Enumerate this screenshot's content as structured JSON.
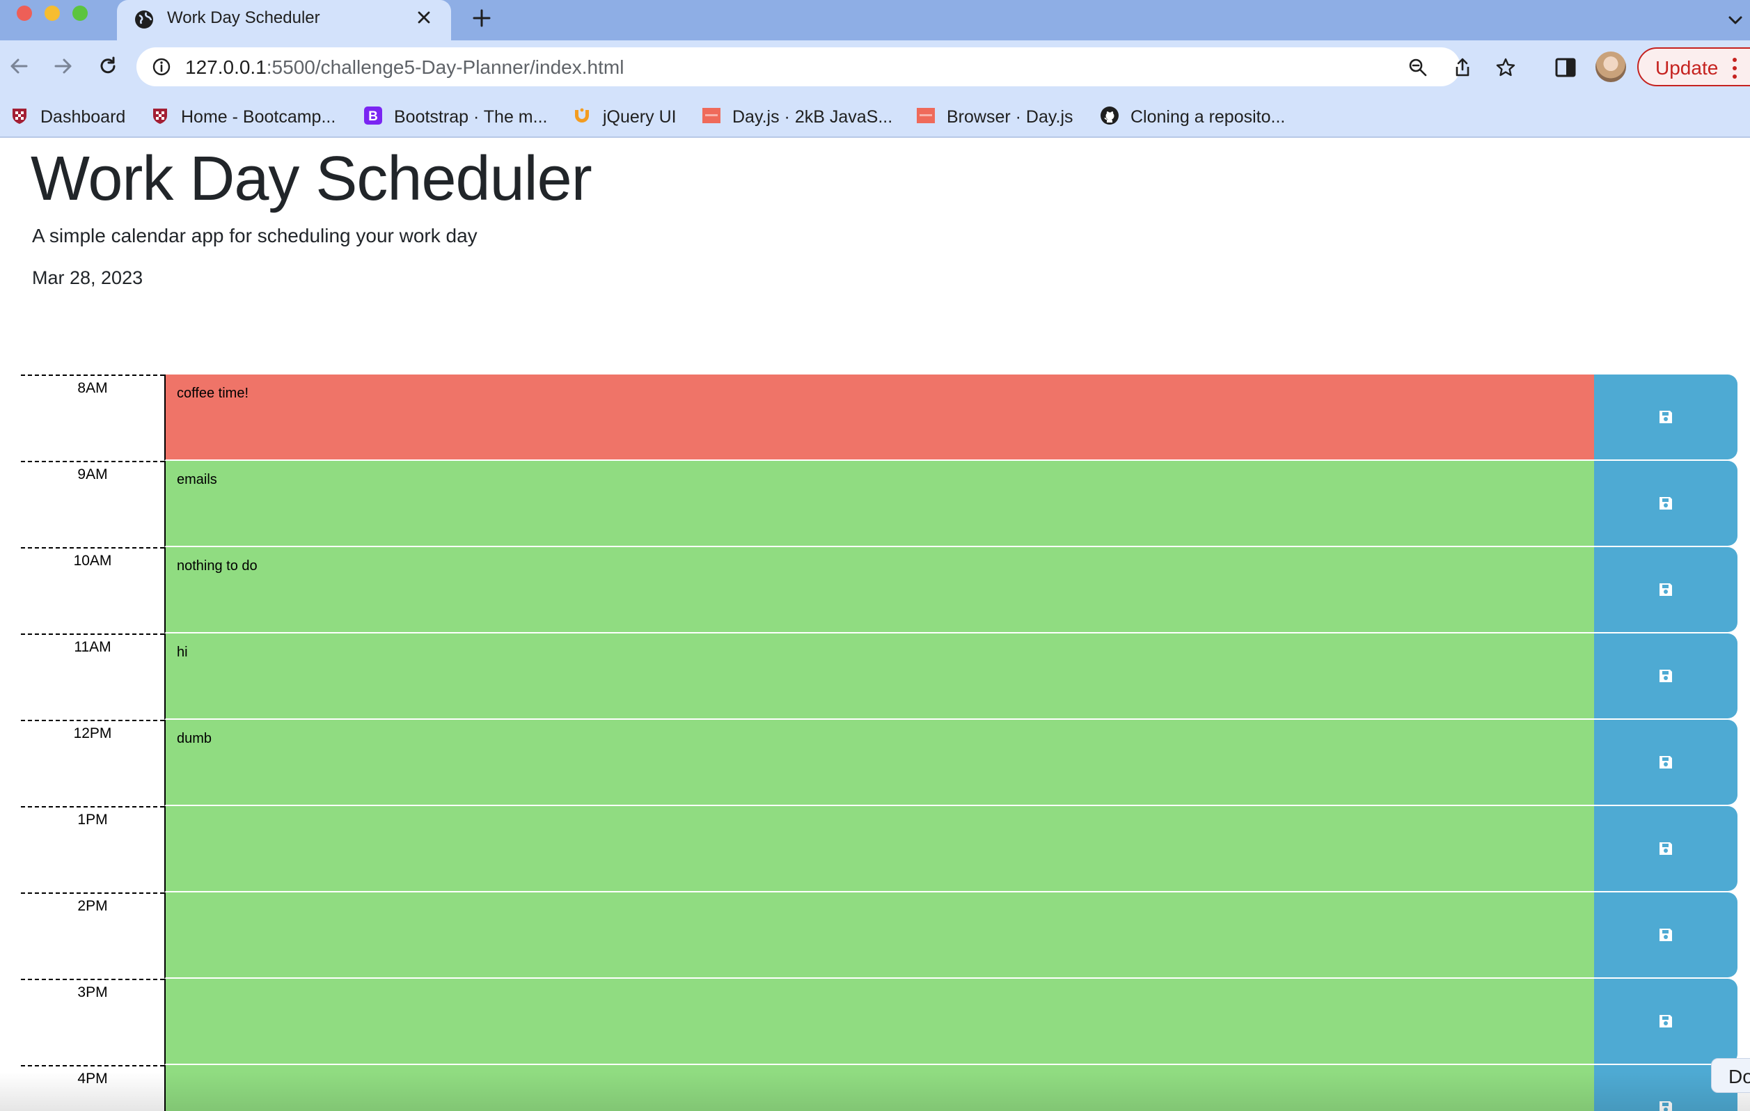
{
  "browser": {
    "tab_title": "Work Day Scheduler",
    "url_host": "127.0.0.1",
    "url_rest": ":5500/challenge5-Day-Planner/index.html",
    "update_label": "Update",
    "bookmarks": [
      {
        "label": "Dashboard",
        "icon": "shield-icon"
      },
      {
        "label": "Home - Bootcamp...",
        "icon": "shield-icon"
      },
      {
        "label": "Bootstrap · The m...",
        "icon": "bootstrap-icon"
      },
      {
        "label": "jQuery UI",
        "icon": "jquery-ui-icon"
      },
      {
        "label": "Day.js · 2kB JavaS...",
        "icon": "dayjs-icon"
      },
      {
        "label": "Browser · Day.js",
        "icon": "dayjs-icon"
      },
      {
        "label": "Cloning a reposito...",
        "icon": "github-icon"
      }
    ]
  },
  "header": {
    "title": "Work Day Scheduler",
    "lead": "A simple calendar app for scheduling your work day",
    "current_day": "Mar 28, 2023"
  },
  "timeblocks": [
    {
      "hour": "8AM",
      "text": "coffee time!",
      "state": "present"
    },
    {
      "hour": "9AM",
      "text": "emails",
      "state": "future"
    },
    {
      "hour": "10AM",
      "text": "nothing to do",
      "state": "future"
    },
    {
      "hour": "11AM",
      "text": "hi",
      "state": "future"
    },
    {
      "hour": "12PM",
      "text": "dumb",
      "state": "future"
    },
    {
      "hour": "1PM",
      "text": "",
      "state": "future"
    },
    {
      "hour": "2PM",
      "text": "",
      "state": "future"
    },
    {
      "hour": "3PM",
      "text": "",
      "state": "future"
    },
    {
      "hour": "4PM",
      "text": "",
      "state": "future"
    }
  ],
  "devtools_pill": "Do",
  "colors": {
    "present": "#ef7468",
    "future": "#90dc81",
    "save_button": "#4eaad3",
    "tab_strip": "#8eaee5",
    "toolbar": "#d3e2fb"
  }
}
